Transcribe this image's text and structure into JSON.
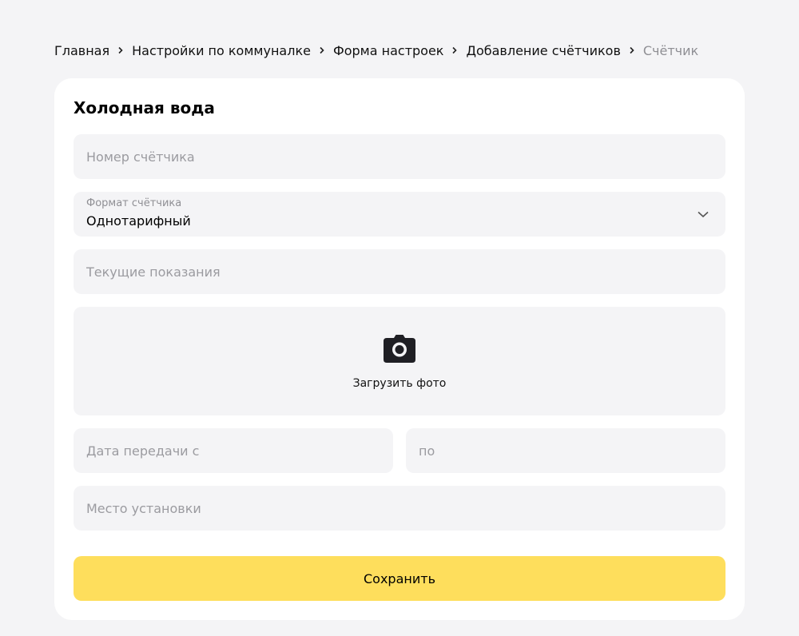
{
  "breadcrumb": {
    "items": [
      {
        "label": "Главная"
      },
      {
        "label": "Настройки по коммуналке"
      },
      {
        "label": "Форма настроек"
      },
      {
        "label": "Добавление счётчиков"
      },
      {
        "label": "Счётчик"
      }
    ]
  },
  "form": {
    "title": "Холодная вода",
    "meter_number": {
      "placeholder": "Номер счётчика",
      "value": ""
    },
    "meter_format": {
      "label": "Формат счётчика",
      "value": "Однотарифный"
    },
    "current_reading": {
      "placeholder": "Текущие показания",
      "value": ""
    },
    "upload_photo": {
      "label": "Загрузить фото",
      "icon": "camera-icon"
    },
    "date_from": {
      "placeholder": "Дата передачи с",
      "value": ""
    },
    "date_to": {
      "placeholder": "по",
      "value": ""
    },
    "location": {
      "placeholder": "Место установки",
      "value": ""
    },
    "save_label": "Сохранить"
  },
  "colors": {
    "page_bg": "#f4f4f6",
    "card_bg": "#ffffff",
    "field_bg": "#f4f4f6",
    "accent": "#fede5c",
    "muted_text": "#8f8f94"
  }
}
